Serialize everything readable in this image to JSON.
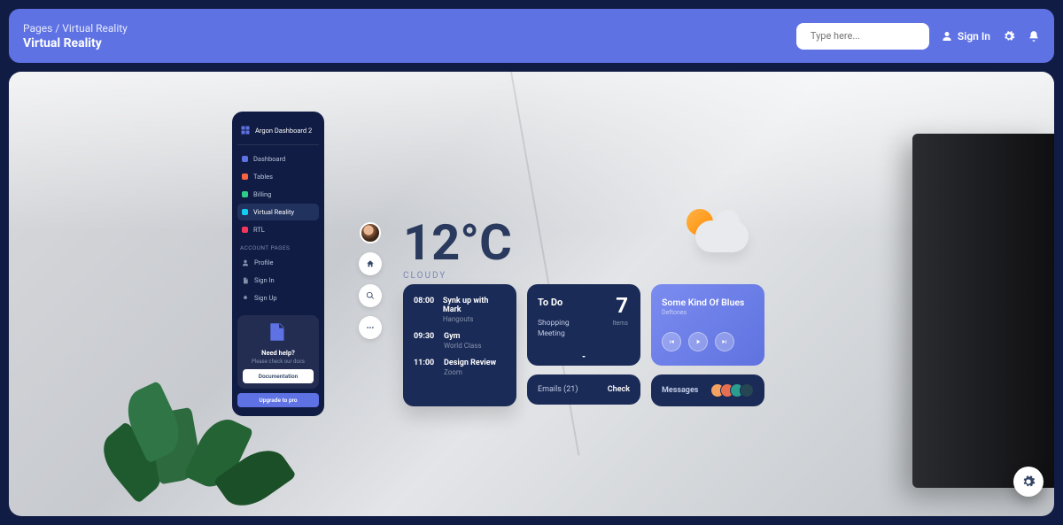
{
  "breadcrumb": {
    "root": "Pages",
    "current": "Virtual Reality"
  },
  "page_title": "Virtual Reality",
  "search": {
    "placeholder": "Type here..."
  },
  "topnav": {
    "signin": "Sign In"
  },
  "brand": "Argon Dashboard 2",
  "nav": {
    "items": [
      {
        "label": "Dashboard"
      },
      {
        "label": "Tables"
      },
      {
        "label": "Billing"
      },
      {
        "label": "Virtual Reality"
      },
      {
        "label": "RTL"
      }
    ],
    "section": "Account Pages",
    "account": [
      {
        "label": "Profile"
      },
      {
        "label": "Sign In"
      },
      {
        "label": "Sign Up"
      }
    ]
  },
  "help": {
    "title": "Need help?",
    "subtitle": "Please check our docs",
    "doc_btn": "Documentation",
    "upgrade_btn": "Upgrade to pro"
  },
  "weather": {
    "temp": "12°C",
    "condition": "Cloudy"
  },
  "schedule": [
    {
      "time": "08:00",
      "title": "Synk up with Mark",
      "sub": "Hangouts"
    },
    {
      "time": "09:30",
      "title": "Gym",
      "sub": "World Class"
    },
    {
      "time": "11:00",
      "title": "Design Review",
      "sub": "Zoom"
    }
  ],
  "todo": {
    "title": "To Do",
    "count": "7",
    "count_label": "Items",
    "items": [
      "Shopping",
      "Meeting"
    ]
  },
  "emails": {
    "label": "Emails (21)",
    "action": "Check"
  },
  "player": {
    "title": "Some Kind Of Blues",
    "artist": "Deftones"
  },
  "messages": {
    "label": "Messages"
  }
}
